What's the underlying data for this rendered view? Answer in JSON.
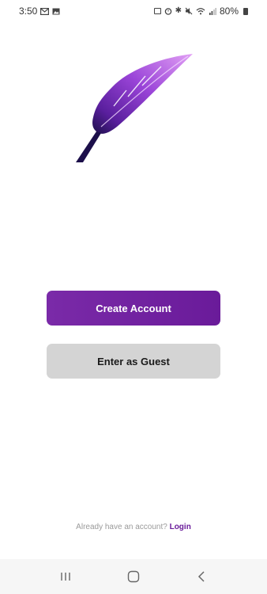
{
  "status_bar": {
    "time": "3:50",
    "battery": "80%",
    "left_icons": [
      "gmail-icon",
      "gallery-icon"
    ],
    "right_icons": [
      "nfc-icon",
      "alarm-icon",
      "bluetooth-icon",
      "mute-icon",
      "wifi-icon",
      "signal-icon",
      "battery-icon"
    ]
  },
  "logo": {
    "icon": "feather-logo-icon",
    "colors": {
      "top": "#d88cf0",
      "mid": "#8e3ad0",
      "bottom": "#1c0f4a"
    }
  },
  "actions": {
    "create_account_label": "Create Account",
    "guest_label": "Enter as Guest"
  },
  "login": {
    "prompt": "Already have an account?",
    "link_label": "Login"
  },
  "nav": {
    "icons": [
      "recent-apps-icon",
      "home-icon",
      "back-icon"
    ]
  },
  "colors": {
    "accent": "#6a1b9a",
    "secondary_button": "#d4d4d4"
  }
}
